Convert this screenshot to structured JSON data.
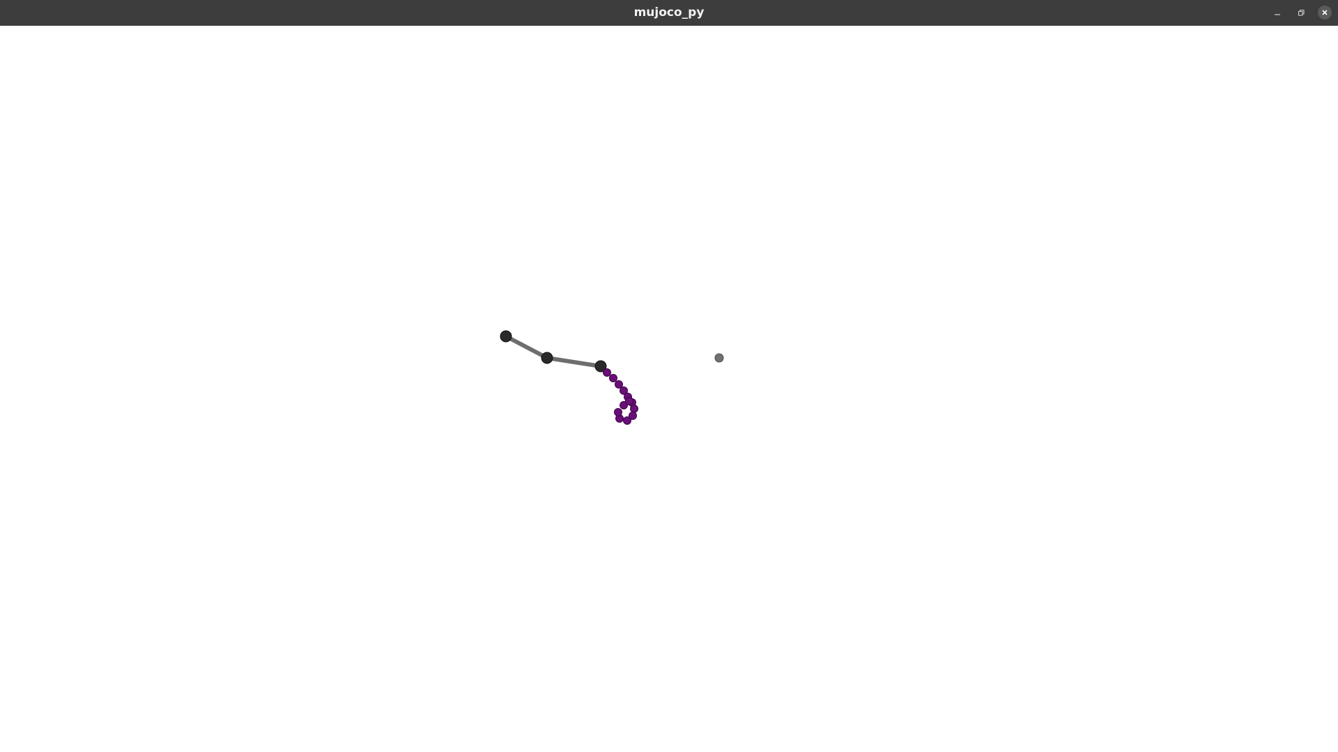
{
  "window": {
    "title": "mujoco_py",
    "controls": {
      "minimize_icon": "minimize-icon",
      "maximize_icon": "maximize-icon",
      "close_icon": "close-icon"
    }
  },
  "colors": {
    "titlebar": "#3d3d3d",
    "title_text": "#f2f2f2",
    "background": "#ffffff",
    "link": "#6e6e6e",
    "joint": "#2a2a2a",
    "rope_bead": "#6a0f7a",
    "target": "#707070"
  }
}
